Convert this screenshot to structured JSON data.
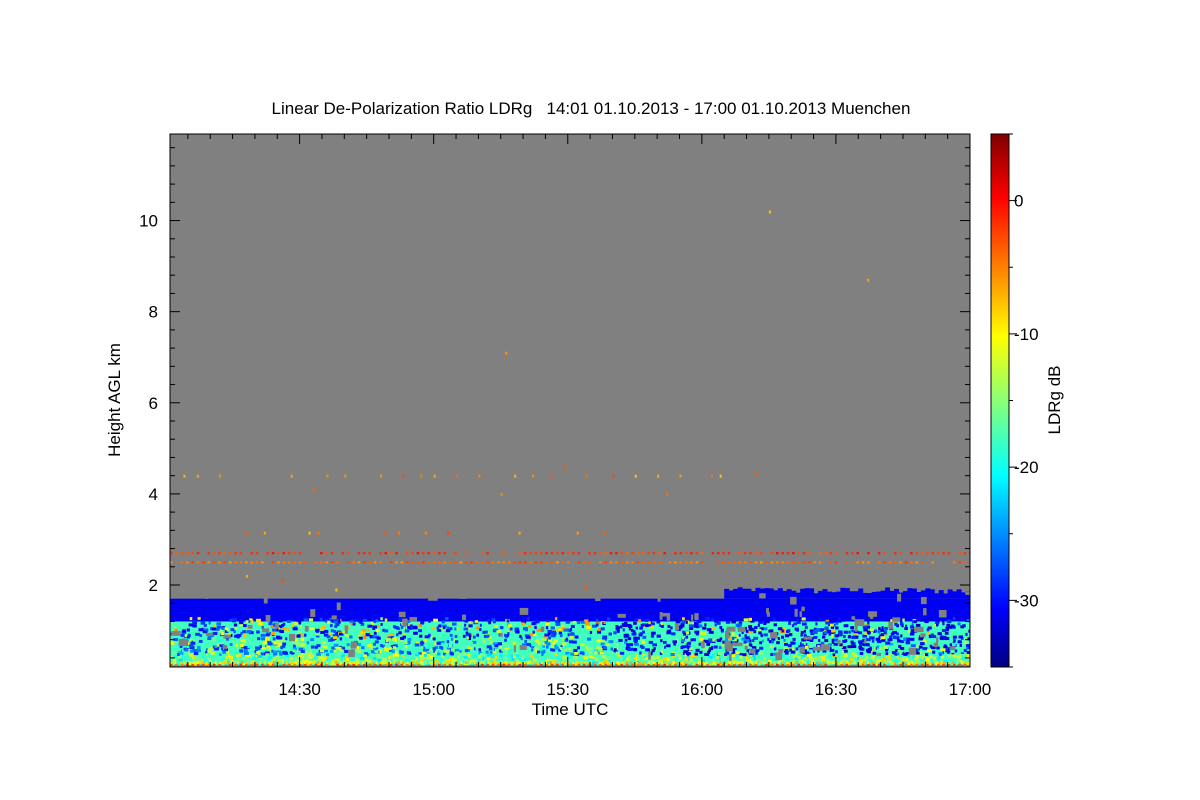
{
  "chart_data": {
    "type": "heatmap",
    "title": "Linear De-Polarization Ratio LDRg   14:01 01.10.2013 - 17:00 01.10.2013 Muenchen",
    "xlabel": "Time UTC",
    "ylabel": "Height AGL km",
    "xlim": [
      "14:01",
      "17:00"
    ],
    "xlim_minutes": [
      841,
      1020
    ],
    "ylim": [
      0.2,
      11.9
    ],
    "x_ticks": [
      {
        "label": "14:30",
        "minutes": 870
      },
      {
        "label": "15:00",
        "minutes": 900
      },
      {
        "label": "15:30",
        "minutes": 930
      },
      {
        "label": "16:00",
        "minutes": 960
      },
      {
        "label": "16:30",
        "minutes": 990
      },
      {
        "label": "17:00",
        "minutes": 1020
      }
    ],
    "y_ticks": [
      {
        "label": "2",
        "value": 2
      },
      {
        "label": "4",
        "value": 4
      },
      {
        "label": "6",
        "value": 6
      },
      {
        "label": "8",
        "value": 8
      },
      {
        "label": "10",
        "value": 10
      }
    ],
    "background_color": "#808080",
    "colorbar": {
      "label": "LDRg dB",
      "range": [
        -35,
        5
      ],
      "ticks": [
        {
          "label": "0",
          "value": 0
        },
        {
          "label": "-10",
          "value": -10
        },
        {
          "label": "-20",
          "value": -20
        },
        {
          "label": "-30",
          "value": -30
        }
      ],
      "colormap": [
        "#000080",
        "#0000ff",
        "#00ffff",
        "#ffff00",
        "#ff0000",
        "#800000"
      ]
    },
    "layers": [
      {
        "desc": "layer",
        "x": [
          841,
          1020
        ],
        "y": [
          0.25,
          1.2
        ],
        "ldr": -18
      },
      {
        "desc": "layer",
        "x": [
          841,
          1020
        ],
        "y": [
          1.2,
          1.7
        ],
        "ldr": -31
      }
    ],
    "range_artifacts": [
      {
        "y": 2.7,
        "ldr": -2
      },
      {
        "y": 2.5,
        "ldr": -4
      },
      {
        "y": 0.25,
        "ldr": -3
      }
    ]
  }
}
